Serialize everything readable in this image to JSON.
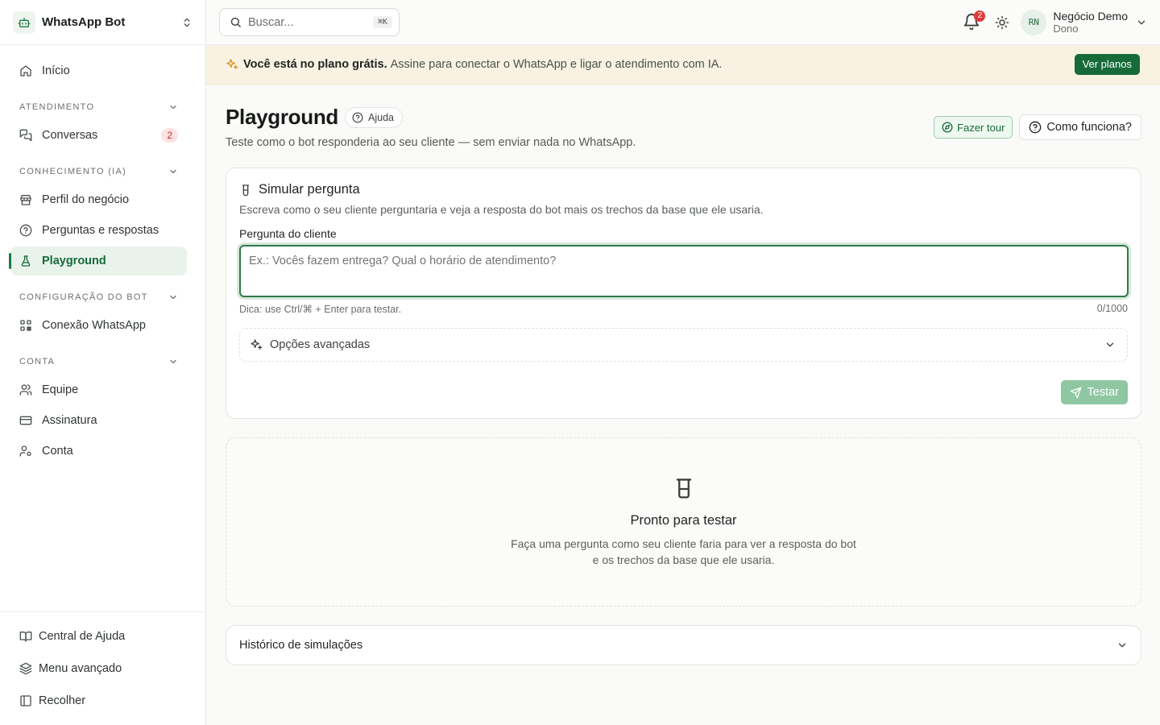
{
  "brand": {
    "name": "WhatsApp Bot"
  },
  "sidebar": {
    "home": {
      "label": "Início"
    },
    "sections": [
      {
        "title": "ATENDIMENTO",
        "items": [
          {
            "label": "Conversas",
            "badge": "2"
          }
        ]
      },
      {
        "title": "CONHECIMENTO (IA)",
        "items": [
          {
            "label": "Perfil do negócio"
          },
          {
            "label": "Perguntas e respostas"
          },
          {
            "label": "Playground",
            "active": true
          }
        ]
      },
      {
        "title": "CONFIGURAÇÃO DO BOT",
        "items": [
          {
            "label": "Conexão WhatsApp"
          }
        ]
      },
      {
        "title": "CONTA",
        "items": [
          {
            "label": "Equipe"
          },
          {
            "label": "Assinatura"
          },
          {
            "label": "Conta"
          }
        ]
      }
    ],
    "bottom": [
      {
        "label": "Central de Ajuda"
      },
      {
        "label": "Menu avançado"
      },
      {
        "label": "Recolher"
      }
    ]
  },
  "topbar": {
    "search_placeholder": "Buscar...",
    "search_shortcut": "⌘K",
    "notifications_count": "2",
    "user": {
      "initials": "RN",
      "name": "Negócio Demo",
      "role": "Dono"
    }
  },
  "banner": {
    "strong": "Você está no plano grátis.",
    "text": "Assine para conectar o WhatsApp e ligar o atendimento com IA.",
    "button": "Ver planos"
  },
  "page": {
    "title": "Playground",
    "help_chip": "Ajuda",
    "subtitle": "Teste como o bot responderia ao seu cliente — sem enviar nada no WhatsApp.",
    "tour_button": "Fazer tour",
    "how_button": "Como funciona?"
  },
  "simulate": {
    "title": "Simular pergunta",
    "description": "Escreva como o seu cliente perguntaria e veja a resposta do bot mais os trechos da base que ele usaria.",
    "field_label": "Pergunta do cliente",
    "placeholder": "Ex.: Vocês fazem entrega? Qual o horário de atendimento?",
    "value": "",
    "hint": "Dica: use Ctrl/⌘ + Enter para testar.",
    "counter": "0/1000",
    "advanced_label": "Opções avançadas",
    "test_button": "Testar"
  },
  "empty_state": {
    "title": "Pronto para testar",
    "text_line1": "Faça uma pergunta como seu cliente faria para ver a resposta do bot",
    "text_line2": "e os trechos da base que ele usaria."
  },
  "history": {
    "label": "Histórico de simulações"
  },
  "colors": {
    "accent": "#176b3a",
    "accent_light": "#e9f3ec",
    "banner_bg": "#f9f2e3",
    "badge_red": "#e03a3a"
  }
}
